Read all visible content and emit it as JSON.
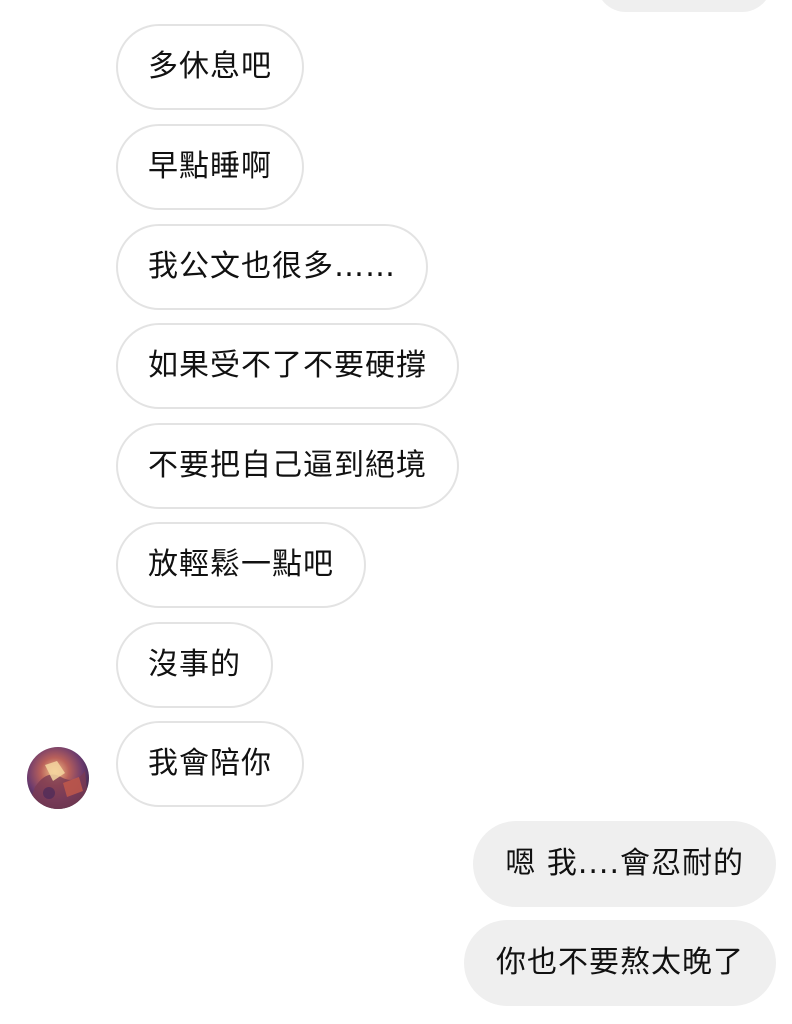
{
  "incoming_messages": [
    {
      "text": "多休息吧"
    },
    {
      "text": "早點睡啊"
    },
    {
      "text": "我公文也很多……"
    },
    {
      "text": "如果受不了不要硬撐"
    },
    {
      "text": "不要把自己逼到絕境"
    },
    {
      "text": "放輕鬆一點吧"
    },
    {
      "text": "沒事的"
    },
    {
      "text": "我會陪你"
    }
  ],
  "outgoing_messages": [
    {
      "text": "嗯 我....會忍耐的"
    },
    {
      "text": "你也不要熬太晚了"
    }
  ],
  "colors": {
    "incoming_border": "#e3e3e3",
    "outgoing_bg": "#efefef",
    "text": "#111111"
  },
  "contact": {
    "avatar_icon": "avatar-icon"
  }
}
